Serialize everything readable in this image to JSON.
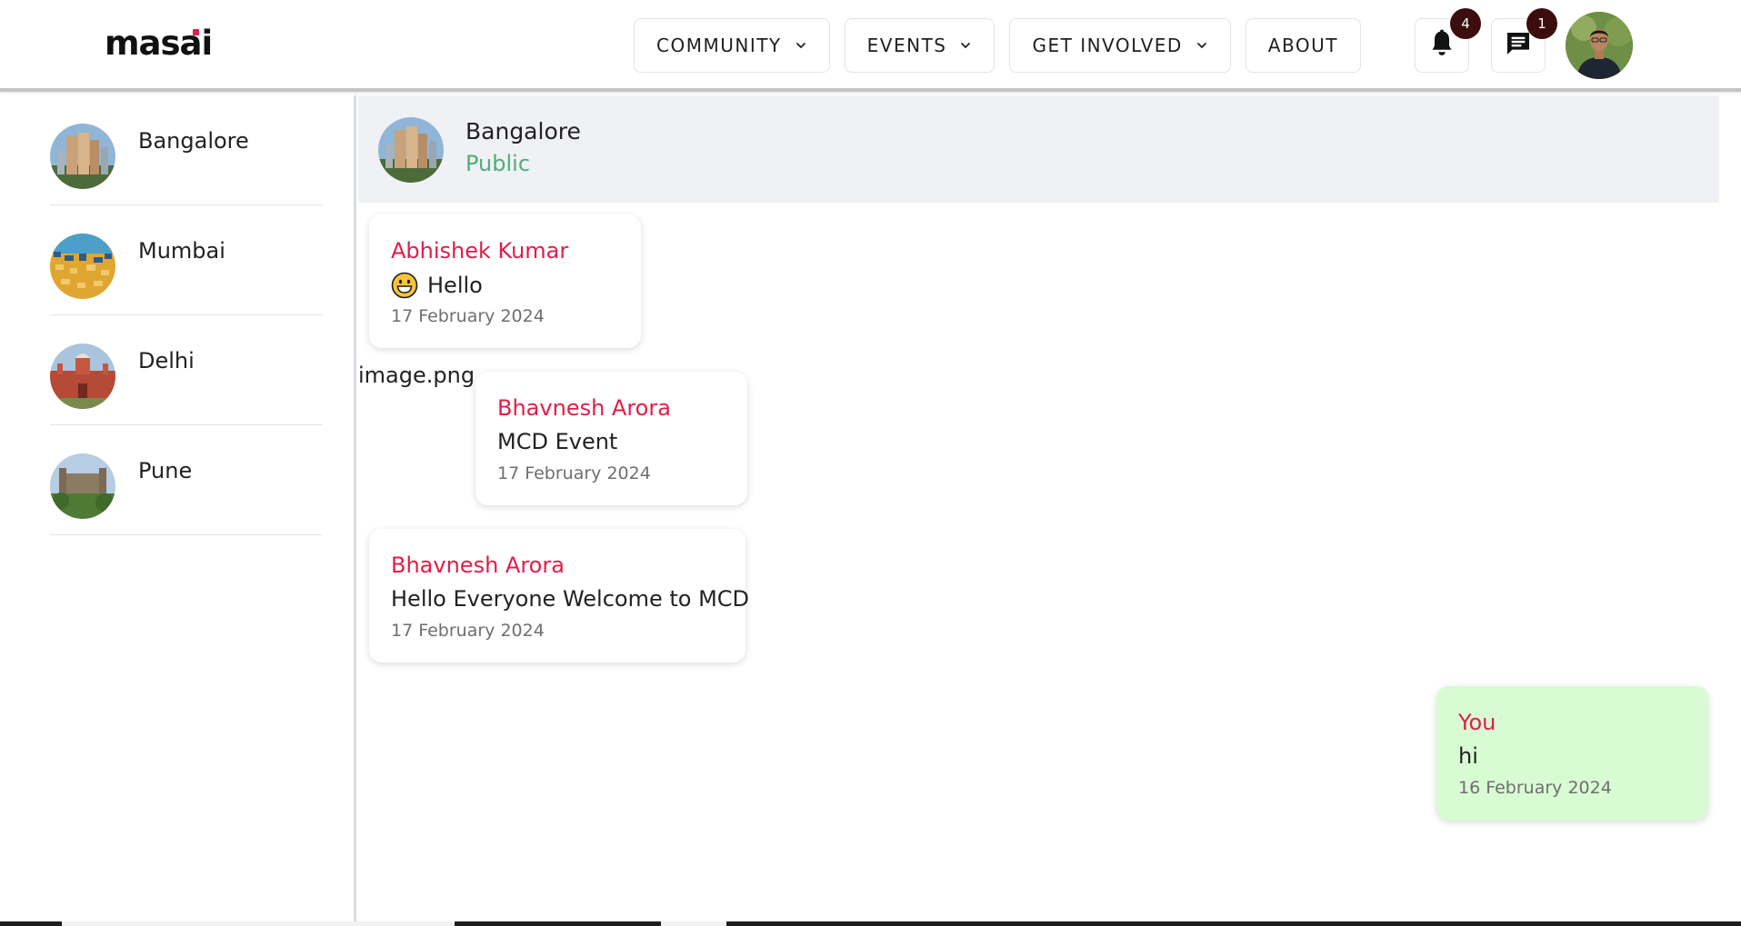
{
  "brand": {
    "logo_text_a": "mas",
    "logo_text_b": "ai"
  },
  "nav": {
    "items": [
      {
        "label": "COMMUNITY",
        "has_dropdown": true
      },
      {
        "label": "EVENTS",
        "has_dropdown": true
      },
      {
        "label": "GET INVOLVED",
        "has_dropdown": true
      },
      {
        "label": "ABOUT",
        "has_dropdown": false
      }
    ],
    "notifications": {
      "icon": "bell-icon",
      "count": "4"
    },
    "messages": {
      "icon": "chat-icon",
      "count": "1"
    }
  },
  "sidebar": {
    "chats": [
      {
        "name": "Bangalore"
      },
      {
        "name": "Mumbai"
      },
      {
        "name": "Delhi"
      },
      {
        "name": "Pune"
      }
    ]
  },
  "chat": {
    "header": {
      "title": "Bangalore",
      "subtitle": "Public"
    },
    "attachment_label": "image.png",
    "messages": [
      {
        "sender": "Abhishek Kumar",
        "text": "Hello",
        "date": "17 February 2024",
        "emoji": "grinning-face"
      },
      {
        "sender": "Bhavnesh Arora",
        "text": "MCD Event",
        "date": "17 February 2024"
      },
      {
        "sender": "Bhavnesh Arora",
        "text": "Hello Everyone Welcome to MCD",
        "date": "17 February 2024"
      },
      {
        "sender": "You",
        "text": "hi",
        "date": "16 February 2024"
      }
    ]
  },
  "colors": {
    "accent_red": "#e11d48",
    "public_green": "#4caf7a",
    "own_bubble": "#d9fbd3",
    "badge": "#3b0d0d",
    "header_bg": "#f0f1f4"
  }
}
